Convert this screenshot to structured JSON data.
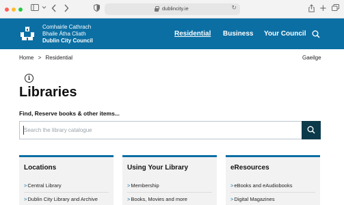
{
  "browser": {
    "url": "dublincity.ie"
  },
  "header": {
    "brand_line1": "Comhairle Cathrach",
    "brand_line2": "Bhaile Átha Cliath",
    "brand_line3": "Dublin City Council",
    "nav": [
      "Residential",
      "Business",
      "Your Council"
    ]
  },
  "breadcrumb": {
    "home": "Home",
    "separator": ">",
    "current": "Residential"
  },
  "language_link": "Gaeilge",
  "page": {
    "title": "Libraries",
    "subtitle": "Find, Reserve books & other items...",
    "search_placeholder": "Search the library catalogue"
  },
  "cards": [
    {
      "title": "Locations",
      "items": [
        "Central Library",
        "Dublin City Library and Archive"
      ]
    },
    {
      "title": "Using Your Library",
      "items": [
        "Membership",
        "Books, Movies and more"
      ]
    },
    {
      "title": "eResources",
      "items": [
        "eBooks and eAudiobooks",
        "Digital Magazines"
      ]
    }
  ],
  "colors": {
    "header_blue": "#0b6fa4",
    "search_button": "#0b3a4a",
    "card_bg": "#f2f2f2"
  },
  "icons": [
    "sidebar-icon",
    "back-icon",
    "forward-icon",
    "shield-icon",
    "lock-icon",
    "reload-icon",
    "share-icon",
    "new-tab-icon",
    "tabs-icon",
    "castle-logo-icon",
    "search-icon",
    "info-icon"
  ]
}
